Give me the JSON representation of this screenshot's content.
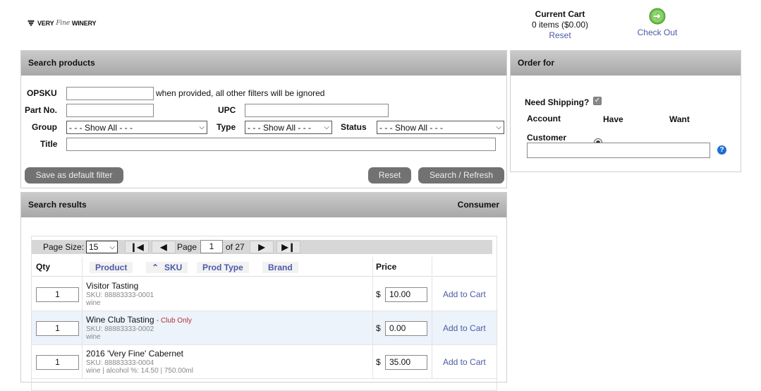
{
  "header": {
    "logo": {
      "very": "VERY",
      "fine": "Fine",
      "winery": "WINERY"
    },
    "cart": {
      "title": "Current Cart",
      "count": "0 items ($0.00)",
      "reset": "Reset"
    },
    "checkout": {
      "label": "Check Out"
    }
  },
  "search": {
    "title": "Search products",
    "opsku": {
      "label": "OPSKU",
      "value": "",
      "hint": "when provided, all other filters will be ignored"
    },
    "partno": {
      "label": "Part No.",
      "value": ""
    },
    "upc": {
      "label": "UPC",
      "value": ""
    },
    "group": {
      "label": "Group",
      "selected": "- - - Show All - - -"
    },
    "type": {
      "label": "Type",
      "selected": "- - - Show All - - -"
    },
    "status": {
      "label": "Status",
      "selected": "- - - Show All - - -"
    },
    "title_field": {
      "label": "Title",
      "value": ""
    },
    "buttons": {
      "save_default": "Save as default filter",
      "reset": "Reset",
      "search": "Search / Refresh"
    }
  },
  "order": {
    "title": "Order for",
    "need_shipping": "Need Shipping?",
    "account_label": "Account",
    "have": "Have",
    "want": "Want",
    "customer_label": "Customer",
    "customer_value": "",
    "help_glyph": "?"
  },
  "results": {
    "title": "Search results",
    "mode": "Consumer",
    "pager": {
      "page_size_label": "Page Size:",
      "page_size": "15",
      "page_label": "Page",
      "page": "1",
      "of": "of 27"
    },
    "columns": {
      "qty": "Qty",
      "product": "Product",
      "sku": "SKU",
      "prod_type": "Prod Type",
      "brand": "Brand",
      "price": "Price"
    },
    "rows": [
      {
        "qty": "1",
        "name": "Visitor Tasting",
        "badge": "",
        "sku": "SKU: 88883333-0001",
        "meta": "wine",
        "currency": "$",
        "price": "10.00",
        "action": "Add to Cart"
      },
      {
        "qty": "1",
        "name": "Wine Club Tasting",
        "badge": "- Club Only",
        "sku": "SKU: 88883333-0002",
        "meta": "wine",
        "currency": "$",
        "price": "0.00",
        "action": "Add to Cart"
      },
      {
        "qty": "1",
        "name": "2016 'Very Fine' Cabernet",
        "badge": "",
        "sku": "SKU: 88883333-0004",
        "meta": "wine | alcohol %: 14.50 | 750.00ml",
        "currency": "$",
        "price": "35.00",
        "action": "Add to Cart"
      }
    ]
  },
  "colors": {
    "accent_link": "#4b5aa8",
    "button_bg": "#727272",
    "club_only": "#b03030",
    "alt_row": "#edf3fb"
  }
}
